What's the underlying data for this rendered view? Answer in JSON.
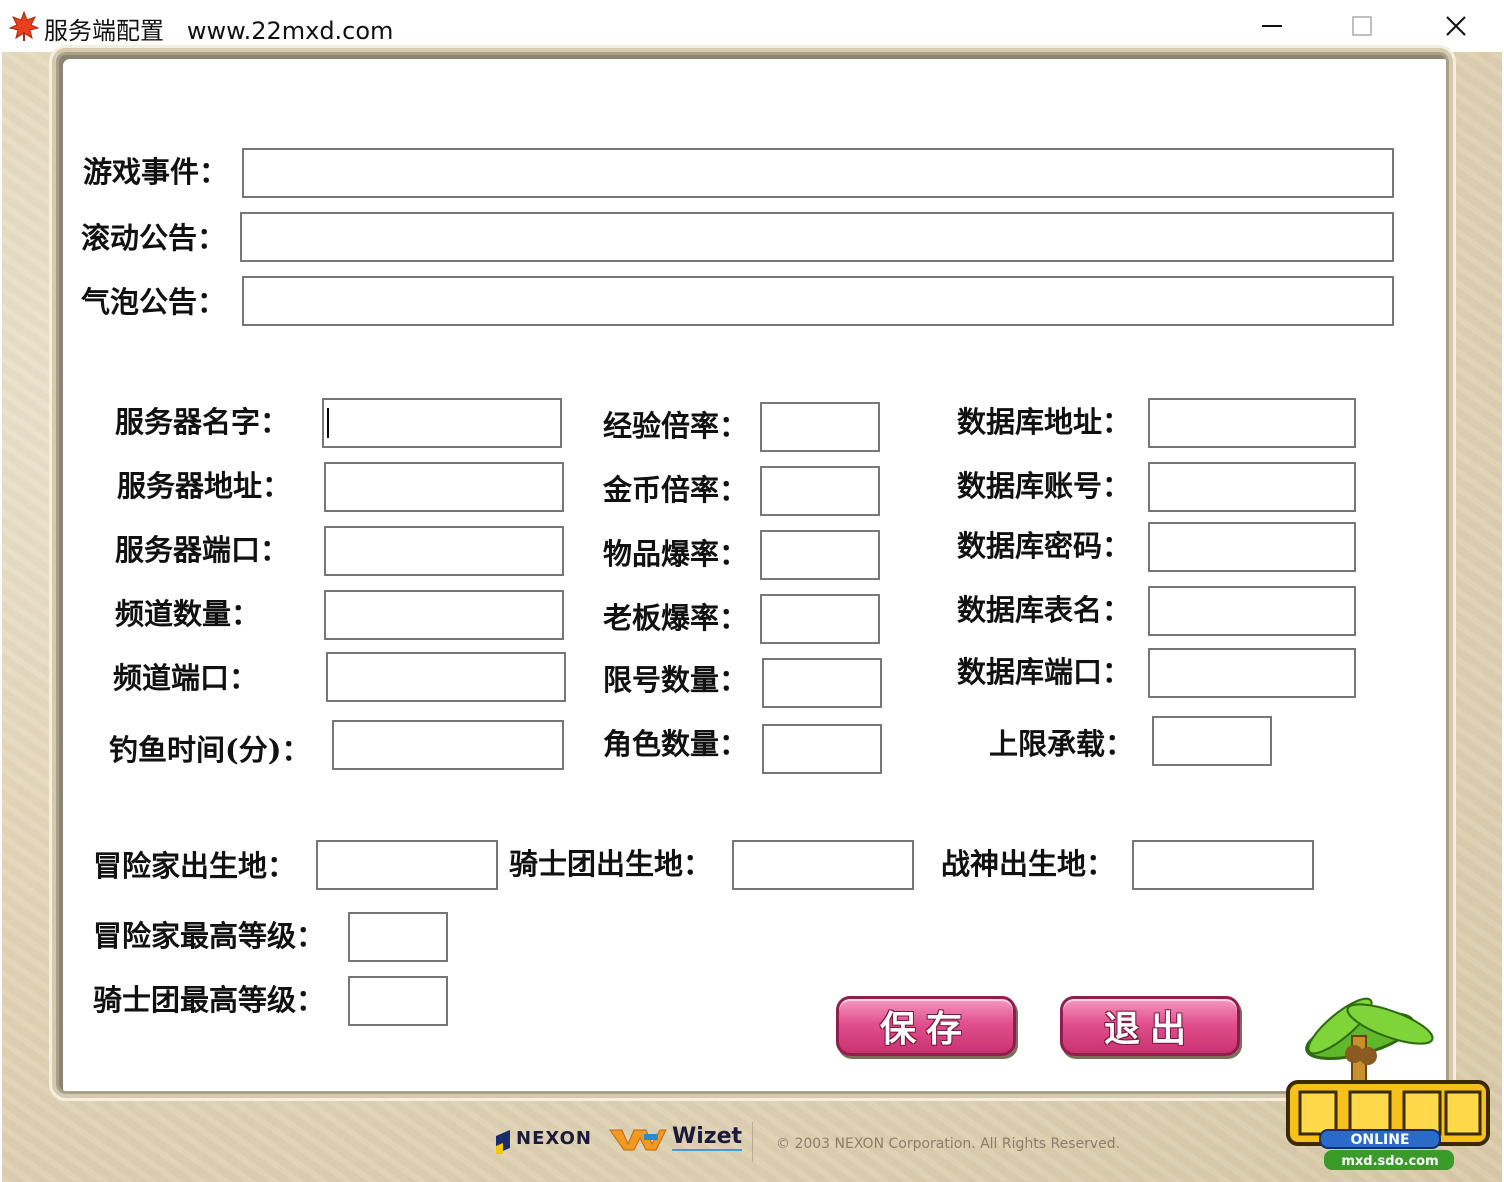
{
  "window": {
    "title": "服务端配置   www.22mxd.com",
    "controls": {
      "minimize": "—",
      "maximize": "☐",
      "close": "✕"
    }
  },
  "announcements": {
    "game_event_label": "游戏事件：",
    "scroll_notice_label": "滚动公告：",
    "bubble_notice_label": "气泡公告："
  },
  "server": {
    "name_label": "服务器名字：",
    "address_label": "服务器地址：",
    "port_label": "服务器端口：",
    "channel_count_label": "频道数量：",
    "channel_port_label": "频道端口：",
    "fishing_time_label": "钓鱼时间(分)："
  },
  "rates": {
    "exp_label": "经验倍率：",
    "gold_label": "金币倍率：",
    "item_drop_label": "物品爆率：",
    "boss_drop_label": "老板爆率：",
    "account_limit_label": "限号数量：",
    "character_count_label": "角色数量："
  },
  "database": {
    "address_label": "数据库地址：",
    "account_label": "数据库账号：",
    "password_label": "数据库密码：",
    "table_label": "数据库表名：",
    "port_label": "数据库端口：",
    "capacity_label": "上限承载："
  },
  "spawn": {
    "adventurer_label": "冒险家出生地：",
    "knight_label": "骑士团出生地：",
    "aran_label": "战神出生地：",
    "adventurer_max_level_label": "冒险家最高等级：",
    "knight_max_level_label": "骑士团最高等级："
  },
  "buttons": {
    "save": "保存",
    "exit": "退出"
  },
  "footer": {
    "nexon": "NEXON",
    "wizet": "Wizet",
    "copyright": "© 2003 NEXON Corporation. All Rights Reserved."
  },
  "logo": {
    "online": "ONLINE",
    "site": "mxd.sdo.com"
  },
  "colors": {
    "button_pink": "#e0508f",
    "background_parchment": "#e4d7bc"
  }
}
